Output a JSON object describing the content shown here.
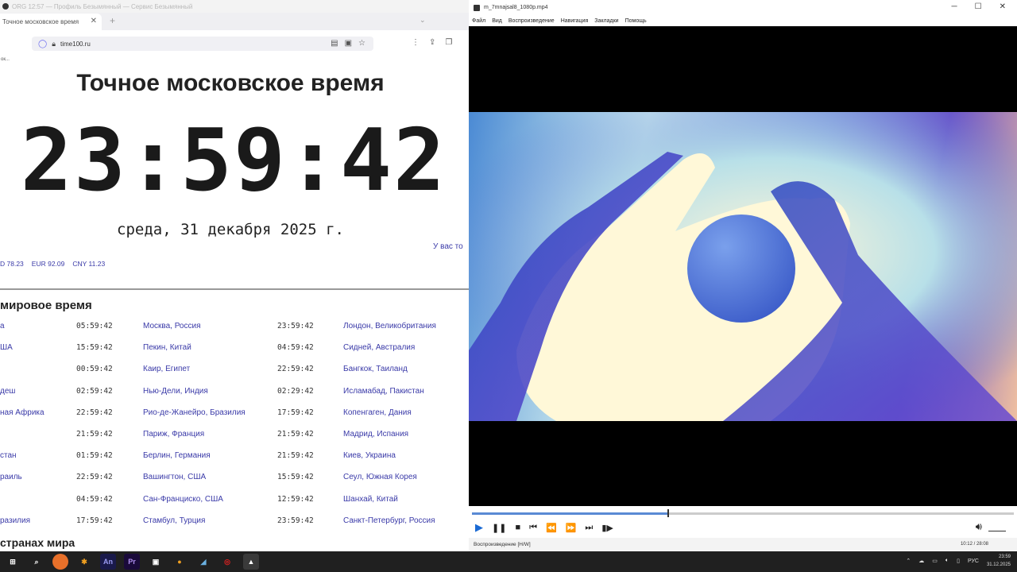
{
  "browser": {
    "window_title": "ORG 12:57 — Профиль Безымянный — Сервис Безымянный",
    "tab_title": "Точное московское время",
    "url": "time100.ru",
    "bookmark_label": "ок...",
    "page_title": "Точное московское время",
    "clock": "23:59:42",
    "date": "среда, 31 декабря 2025 г.",
    "notice": "У вас то",
    "rates": [
      "D 78.23",
      "EUR 92.09",
      "CNY 11.23"
    ],
    "world_title": "мировое время",
    "world_rows": [
      {
        "c1": "а",
        "t1": "05:59:42",
        "c2": "Москва, Россия",
        "t2": "23:59:42",
        "c3": "Лондон, Великобритания"
      },
      {
        "c1": "ША",
        "t1": "15:59:42",
        "c2": "Пекин, Китай",
        "t2": "04:59:42",
        "c3": "Сидней, Австралия"
      },
      {
        "c1": "",
        "t1": "00:59:42",
        "c2": "Каир, Египет",
        "t2": "22:59:42",
        "c3": "Бангкок, Таиланд"
      },
      {
        "c1": "деш",
        "t1": "02:59:42",
        "c2": "Нью-Дели, Индия",
        "t2": "02:29:42",
        "c3": "Исламабад, Пакистан"
      },
      {
        "c1": "ная Африка",
        "t1": "22:59:42",
        "c2": "Рио-де-Жанейро, Бразилия",
        "t2": "17:59:42",
        "c3": "Копенгаген, Дания"
      },
      {
        "c1": "",
        "t1": "21:59:42",
        "c2": "Париж, Франция",
        "t2": "21:59:42",
        "c3": "Мадрид, Испания"
      },
      {
        "c1": "стан",
        "t1": "01:59:42",
        "c2": "Берлин, Германия",
        "t2": "21:59:42",
        "c3": "Киев, Украина"
      },
      {
        "c1": "раиль",
        "t1": "22:59:42",
        "c2": "Вашингтон, США",
        "t2": "15:59:42",
        "c3": "Сеул, Южная Корея"
      },
      {
        "c1": "",
        "t1": "04:59:42",
        "c2": "Сан-Франциско, США",
        "t2": "12:59:42",
        "c3": "Шанхай, Китай"
      },
      {
        "c1": "разилия",
        "t1": "17:59:42",
        "c2": "Стамбул, Турция",
        "t2": "23:59:42",
        "c3": "Санкт-Петербург, Россия"
      }
    ],
    "countries_title": "странах мира"
  },
  "player": {
    "window_title": "m_7mnajsal8_1080p.mp4",
    "menu": [
      "Файл",
      "Вид",
      "Воспроизведение",
      "Навигация",
      "Закладки",
      "Помощь"
    ],
    "status": "Воспроизведение [H/W]",
    "time": "10:12 / 28:08",
    "progress": 0.36
  },
  "taskbar": {
    "lang": "РУС",
    "time": "23:59",
    "date": "31.12.2025"
  },
  "colors": {
    "link": "#3a3aa8",
    "accent_play": "#1a6ad4",
    "taskbar": "#202020"
  }
}
